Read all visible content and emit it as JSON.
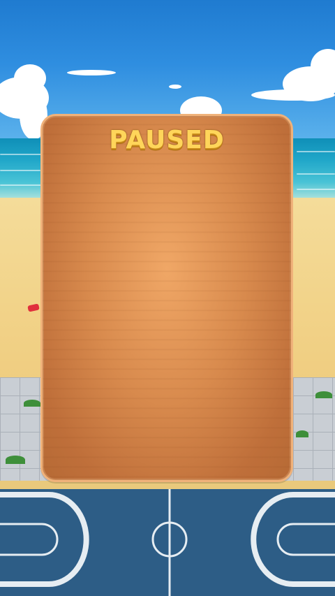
{
  "pause_panel": {
    "title": "PAUSED"
  },
  "colors": {
    "panel_wood": "#d88a4d",
    "panel_border": "#f0b27a",
    "title_gold": "#ffd55a",
    "sky": "#2f8ee0",
    "sea": "#21a7c9",
    "sand": "#f2d389",
    "court": "#2d5d86"
  }
}
